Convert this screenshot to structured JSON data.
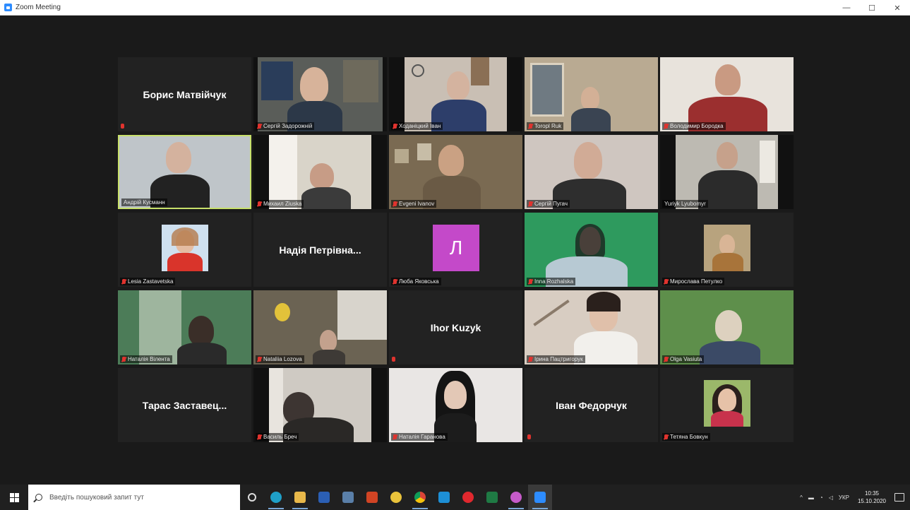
{
  "window": {
    "title": "Zoom Meeting",
    "minimize": "—",
    "maximize": "☐",
    "close": "✕"
  },
  "tiles": [
    {
      "name": "Борис Матвійчук",
      "mode": "name"
    },
    {
      "name": "Сергій Задорожній",
      "mode": "video",
      "bg": "#5a5d59"
    },
    {
      "name": "Ходаніцкий Іван",
      "mode": "video",
      "bg": "#c9bfb4"
    },
    {
      "name": "Toropl Ruk",
      "mode": "video",
      "bg": "#b9aa92"
    },
    {
      "name": "Володимир Бородка",
      "mode": "video",
      "bg": "#e8e3dc"
    },
    {
      "name": "Андрій Кусманн",
      "mode": "video",
      "bg": "#bfc5c9",
      "active": true
    },
    {
      "name": "Михаил Ziuska",
      "mode": "video",
      "bg": "#d9d4c9"
    },
    {
      "name": "Evgeni Ivanov",
      "mode": "video",
      "bg": "#7a6a52"
    },
    {
      "name": "Сергій Пугач",
      "mode": "video",
      "bg": "#cfc6c0"
    },
    {
      "name": "Yuriyk Lyubomyr",
      "mode": "video",
      "bg": "#bdbab2"
    },
    {
      "name": "Lesia Zastavetska",
      "mode": "thumb"
    },
    {
      "name": "Надія Петрівна...",
      "mode": "name"
    },
    {
      "name": "Люба Яковська",
      "mode": "avatar",
      "initial": "Л"
    },
    {
      "name": "Inna Rozhalska",
      "mode": "video",
      "bg": "#2e9a5e"
    },
    {
      "name": "Мирослава Петулко",
      "mode": "thumb"
    },
    {
      "name": "Наталія Вілента",
      "mode": "video",
      "bg": "#4c7c58"
    },
    {
      "name": "Nataliia Lozova",
      "mode": "video",
      "bg": "#6b6353"
    },
    {
      "name": "Ihor Kuzyk",
      "mode": "name"
    },
    {
      "name": "Ірина Пацтригорук",
      "mode": "video",
      "bg": "#d8cdc2"
    },
    {
      "name": "Olga Vasiuta",
      "mode": "video",
      "bg": "#5e8f4b"
    },
    {
      "name": "Тарас Заставец...",
      "mode": "name"
    },
    {
      "name": "Василь Бреч",
      "mode": "video",
      "bg": "#cfcac3"
    },
    {
      "name": "Наталія Гаранова",
      "mode": "video",
      "bg": "#e9e6e4"
    },
    {
      "name": "Іван Федорчук",
      "mode": "name"
    },
    {
      "name": "Тетяна Бовкун",
      "mode": "thumb"
    }
  ],
  "taskbar": {
    "search_placeholder": "Введіть пошуковий запит тут",
    "lang": "УКР",
    "time": "10:35",
    "date": "15.10.2020"
  }
}
